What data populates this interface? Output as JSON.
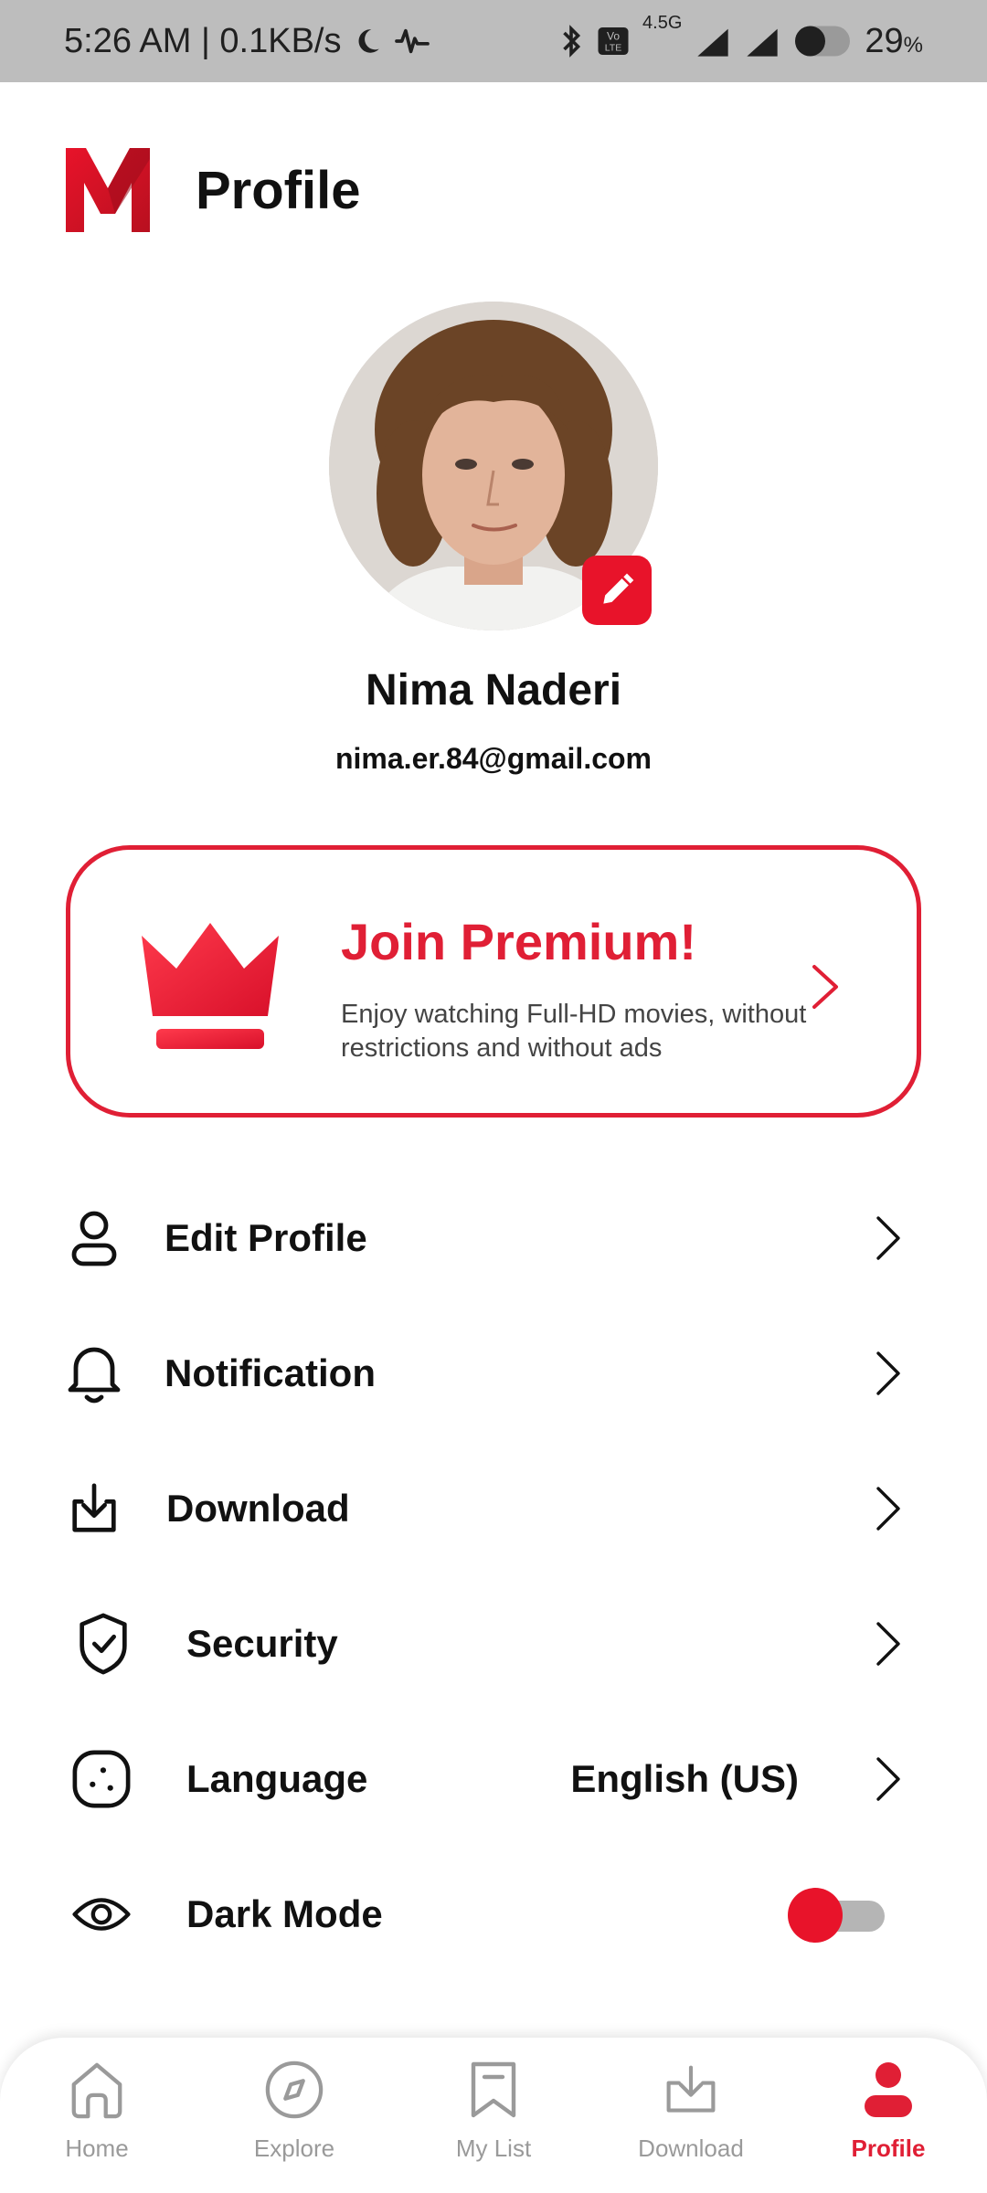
{
  "status_bar": {
    "time_speed": "5:26 AM | 0.1KB/s",
    "network": "4.5G",
    "battery": "29",
    "battery_unit": "%"
  },
  "header": {
    "title": "Profile"
  },
  "profile": {
    "name": "Nima Naderi",
    "email": "nima.er.84@gmail.com"
  },
  "premium": {
    "title": "Join Premium!",
    "description": "Enjoy watching Full-HD movies, without restrictions and without ads"
  },
  "menu": {
    "items": [
      {
        "label": "Edit Profile",
        "icon": "user-icon"
      },
      {
        "label": "Notification",
        "icon": "bell-icon"
      },
      {
        "label": "Download",
        "icon": "download-icon"
      },
      {
        "label": "Security",
        "icon": "shield-icon"
      },
      {
        "label": "Language",
        "icon": "language-icon",
        "value": "English (US)"
      },
      {
        "label": "Dark Mode",
        "icon": "eye-icon",
        "toggle": false
      }
    ]
  },
  "bottom_nav": {
    "items": [
      {
        "label": "Home",
        "icon": "home-icon"
      },
      {
        "label": "Explore",
        "icon": "compass-icon"
      },
      {
        "label": "My List",
        "icon": "bookmark-icon"
      },
      {
        "label": "Download",
        "icon": "download-icon"
      },
      {
        "label": "Profile",
        "icon": "profile-icon",
        "active": true
      }
    ]
  },
  "colors": {
    "accent": "#e01f35",
    "muted": "#9a9a9a"
  }
}
